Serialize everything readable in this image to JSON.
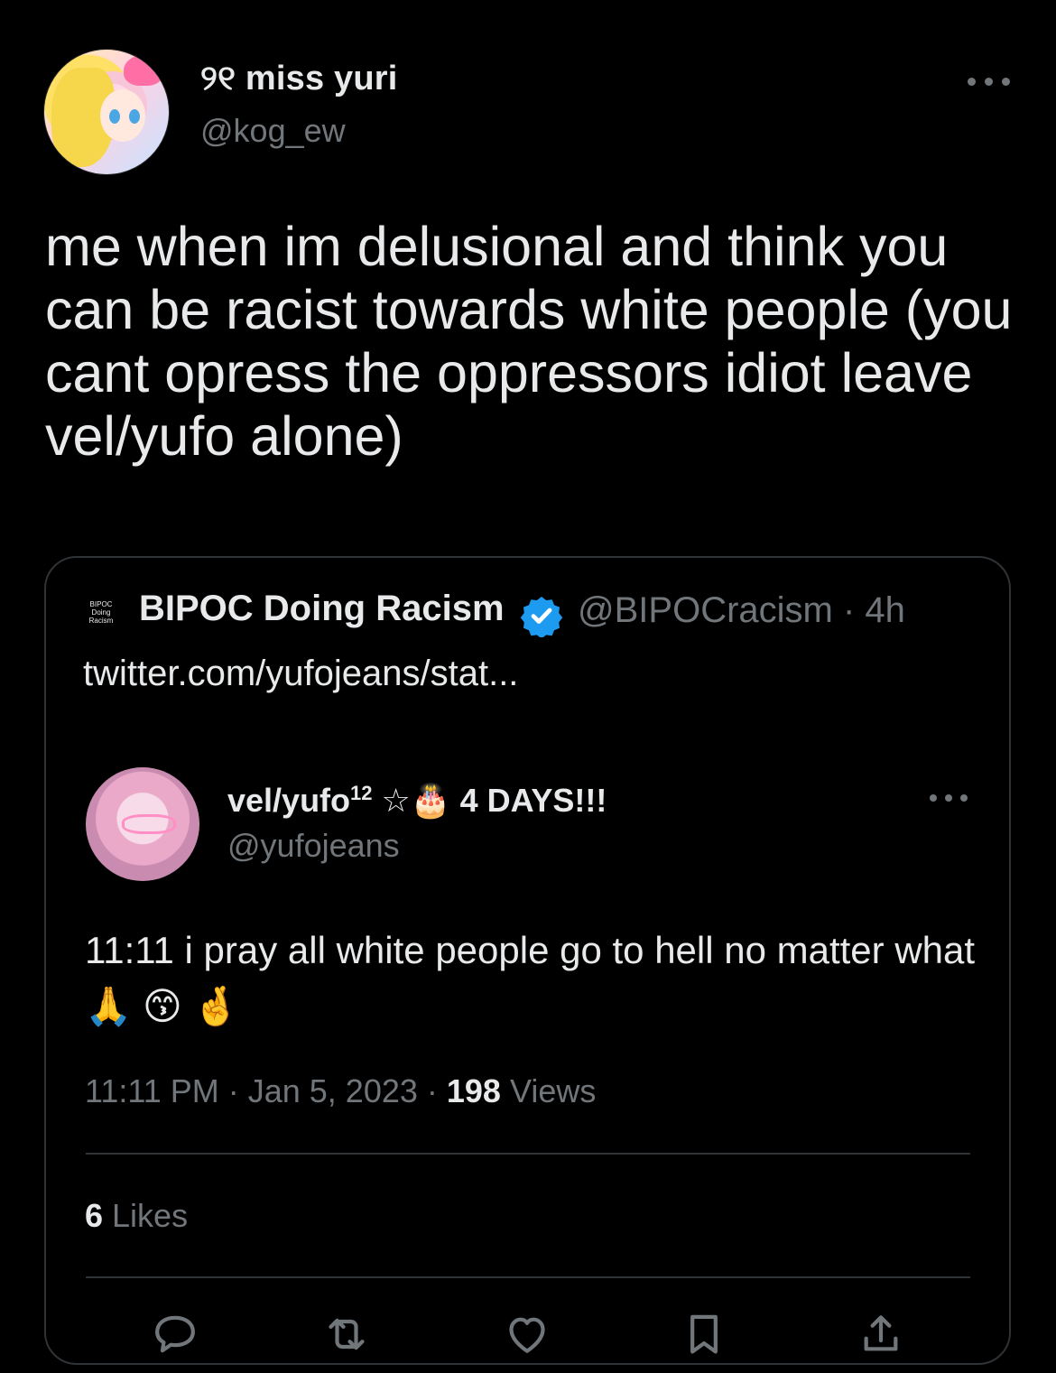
{
  "tweet": {
    "display_name": "୨୧ miss yuri",
    "handle": "@kog_ew",
    "text": "me when im delusional and think you can be racist towards white people (you cant opress the oppressors idiot leave vel/yufo alone)"
  },
  "quote": {
    "avatar_text_1": "BIPOC",
    "avatar_text_2": "Doing",
    "avatar_text_3": "Racism",
    "author": "BIPOC Doing Racism",
    "verified": true,
    "handle_time": "@BIPOCracism · 4h",
    "link": "twitter.com/yufojeans/stat..."
  },
  "nested": {
    "name": "vel/yufo",
    "name_sup": "12",
    "name_suffix": " ☆🎂 4 DAYS!!!",
    "handle": "@yufojeans",
    "text": "11:11 i pray all white people go to hell no matter what 🙏 😙 🤞",
    "meta_prefix": "11:11 PM · Jan 5, 2023 · ",
    "views_count": "198",
    "views_label": " Views",
    "likes_count": "6",
    "likes_label": " Likes"
  },
  "colors": {
    "background": "#000000",
    "text": "#e7e9ea",
    "muted": "#71767b",
    "border": "#2f3336",
    "verified": "#1d9bf0"
  },
  "icons": [
    "more-icon",
    "verified-badge-icon",
    "reply-icon",
    "retweet-icon",
    "like-icon",
    "bookmark-icon",
    "share-icon"
  ]
}
